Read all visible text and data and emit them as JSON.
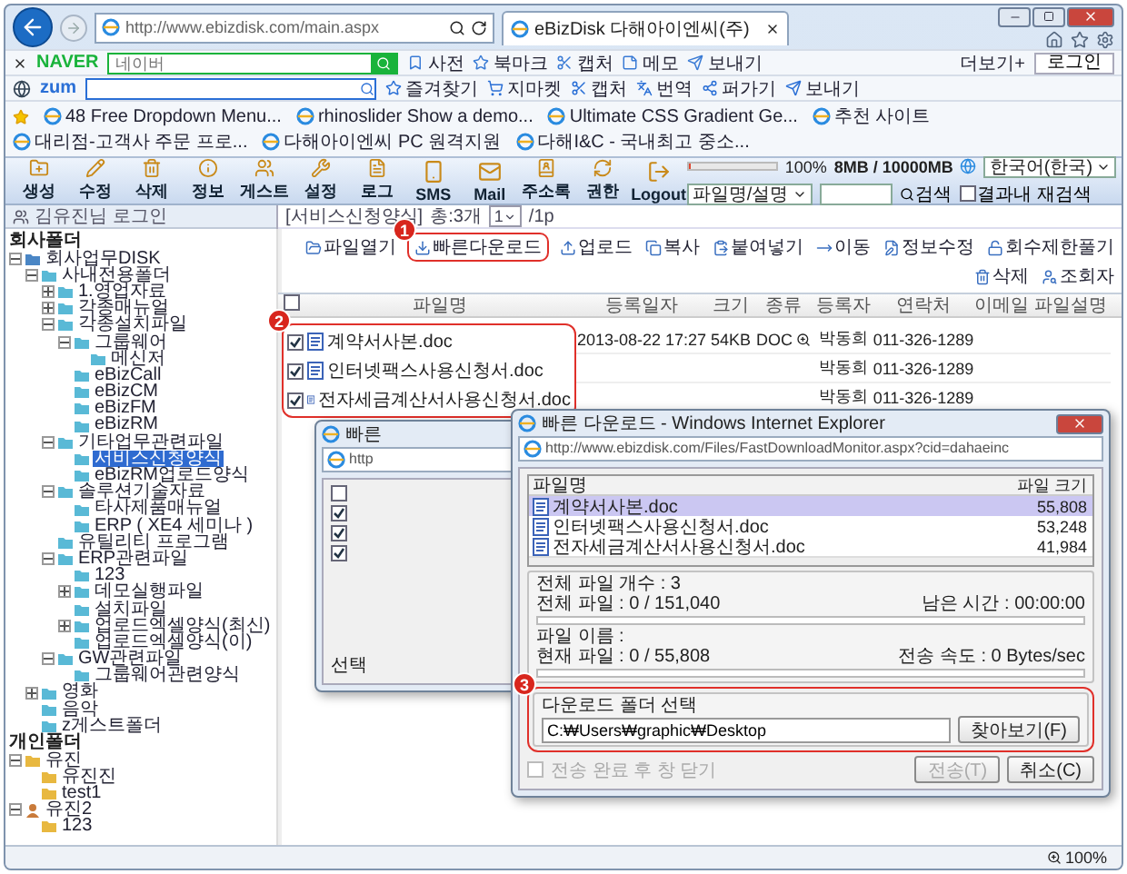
{
  "browser": {
    "address": "http://www.ebizdisk.com/main.aspx",
    "tab": "eBizDisk 다해아이엔씨(주)"
  },
  "naver_bar": {
    "logo": "NAVER",
    "search_placeholder": "네이버",
    "items": [
      "사전",
      "북마크",
      "캡처",
      "메모",
      "보내기"
    ],
    "more": "더보기+",
    "login": "로그인"
  },
  "zum_bar": {
    "logo": "zum",
    "items": [
      "즐겨찾기",
      "지마켓",
      "캡처",
      "번역",
      "퍼가기",
      "보내기"
    ]
  },
  "favorites": [
    "48 Free Dropdown Menu...",
    "rhinoslider Show a demo...",
    "Ultimate CSS Gradient Ge...",
    "추천 사이트",
    "대리점-고객사 주문 프로...",
    "다해아이엔씨 PC 원격지원",
    "다해I&C - 국내최고 중소..."
  ],
  "app_toolbar": {
    "tools": [
      "생성",
      "수정",
      "삭제",
      "정보",
      "게스트",
      "설정",
      "로그",
      "SMS",
      "Mail",
      "주소록",
      "권한",
      "Logout"
    ],
    "storage": {
      "level": 0.01,
      "percent": "100%",
      "usage": "8MB / 10000MB"
    },
    "language": "한국어(한국)",
    "search_scope": "파일명/설명",
    "search_button": "검색",
    "refine": {
      "label": "결과내 재검색",
      "checked": false
    }
  },
  "sidebar": {
    "login": "김유진님 로그인",
    "sections": [
      {
        "title": "회사폴더",
        "tree": [
          {
            "label": "회사업무DISK",
            "kind": "drive",
            "expanded": true,
            "selected": false,
            "children": [
              {
                "label": "사내전용폴더",
                "kind": "folder",
                "expanded": true,
                "selected": false,
                "children": [
                  {
                    "label": "1.영업자료",
                    "kind": "folder",
                    "expanded": false,
                    "selected": false
                  },
                  {
                    "label": "각종매뉴얼",
                    "kind": "folder",
                    "expanded": false,
                    "selected": false
                  },
                  {
                    "label": "각종설치파일",
                    "kind": "folder",
                    "expanded": true,
                    "selected": false,
                    "children": [
                      {
                        "label": "그룹웨어",
                        "kind": "folder",
                        "expanded": true,
                        "selected": false,
                        "children": [
                          {
                            "label": "메신저",
                            "kind": "folder",
                            "selected": false
                          }
                        ]
                      },
                      {
                        "label": "eBizCall",
                        "kind": "folder",
                        "selected": false
                      },
                      {
                        "label": "eBizCM",
                        "kind": "folder",
                        "selected": false
                      },
                      {
                        "label": "eBizFM",
                        "kind": "folder",
                        "selected": false
                      },
                      {
                        "label": "eBizRM",
                        "kind": "folder",
                        "selected": false
                      }
                    ]
                  },
                  {
                    "label": "기타업무관련파일",
                    "kind": "folder",
                    "expanded": true,
                    "selected": false,
                    "children": [
                      {
                        "label": "서비스신청양식",
                        "kind": "folder",
                        "selected": true
                      },
                      {
                        "label": "eBizRM업로드양식",
                        "kind": "folder",
                        "selected": false
                      }
                    ]
                  },
                  {
                    "label": "솔루션기술자료",
                    "kind": "folder",
                    "expanded": true,
                    "selected": false,
                    "children": [
                      {
                        "label": "타사제품매뉴얼",
                        "kind": "folder",
                        "selected": false
                      },
                      {
                        "label": "ERP ( XE4 세미나 )",
                        "kind": "folder",
                        "selected": false
                      }
                    ]
                  },
                  {
                    "label": "유틸리티 프로그램",
                    "kind": "folder",
                    "selected": false
                  },
                  {
                    "label": "ERP관련파일",
                    "kind": "folder",
                    "expanded": true,
                    "selected": false,
                    "children": [
                      {
                        "label": "123",
                        "kind": "folder",
                        "selected": false
                      },
                      {
                        "label": "데모실행파일",
                        "kind": "folder",
                        "expanded": false,
                        "selected": false
                      },
                      {
                        "label": "설치파일",
                        "kind": "folder",
                        "selected": false
                      },
                      {
                        "label": "업로드엑셀양식(최신)",
                        "kind": "folder",
                        "expanded": false,
                        "selected": false
                      },
                      {
                        "label": "업로드엑셀양식(이)",
                        "kind": "folder",
                        "selected": false
                      }
                    ]
                  },
                  {
                    "label": "GW관련파일",
                    "kind": "folder",
                    "expanded": true,
                    "selected": false,
                    "children": [
                      {
                        "label": "그룹웨어관련양식",
                        "kind": "folder",
                        "selected": false
                      }
                    ]
                  }
                ]
              },
              {
                "label": "영화",
                "kind": "folder",
                "expanded": false,
                "selected": false
              },
              {
                "label": "음악",
                "kind": "folder",
                "selected": false
              },
              {
                "label": "z게스트폴더",
                "kind": "folder",
                "selected": false
              }
            ]
          }
        ]
      },
      {
        "title": "개인폴더",
        "tree": [
          {
            "label": "유진",
            "kind": "personal",
            "expanded": true,
            "selected": false,
            "children": [
              {
                "label": "유진진",
                "kind": "personal",
                "selected": false
              },
              {
                "label": "test1",
                "kind": "personal",
                "selected": false
              }
            ]
          },
          {
            "label": "유진2",
            "kind": "user",
            "expanded": true,
            "selected": false,
            "children": [
              {
                "label": "123",
                "kind": "personal",
                "selected": false
              }
            ]
          }
        ]
      }
    ]
  },
  "file_list": {
    "header_checked": false,
    "path": "[서비스신청양식]",
    "count": "총:3개",
    "page": "1",
    "pages": "/1p",
    "actions": [
      "파일열기",
      "빠른다운로드",
      "업로드",
      "복사",
      "붙여넣기",
      "이동",
      "정보수정",
      "회수제한풀기",
      "삭제",
      "조회자"
    ],
    "columns": [
      "파일명",
      "등록일자",
      "크기",
      "종류",
      "등록자",
      "연락처",
      "이메일",
      "파일설명"
    ],
    "rows": [
      {
        "checked": true,
        "name": "계약서사본.doc",
        "date": "2013-08-22 17:27",
        "size": "54KB",
        "type": "DOC",
        "owner": "박동희",
        "phone": "011-326-1289"
      },
      {
        "checked": true,
        "name": "인터넷팩스사용신청서.doc",
        "owner": "박동희",
        "phone": "011-326-1289"
      },
      {
        "checked": true,
        "name": "전자세금계산서사용신청서.doc",
        "owner": "박동희",
        "phone": "011-326-1289"
      }
    ]
  },
  "callouts": [
    "1",
    "2",
    "3"
  ],
  "back_dialog": {
    "title": "빠른",
    "url": "http",
    "header_checked": false,
    "rows": [
      {
        "checked": true
      },
      {
        "checked": true
      },
      {
        "checked": true
      }
    ],
    "footer": "선택"
  },
  "dialog": {
    "title": "빠른 다운로드 - Windows Internet Explorer",
    "url": "http://www.ebizdisk.com/Files/FastDownloadMonitor.aspx?cid=dahaeinc",
    "columns": [
      "파일명",
      "파일 크기"
    ],
    "files": [
      {
        "name": "계약서사본.doc",
        "size": "55,808",
        "selected": true
      },
      {
        "name": "인터넷팩스사용신청서.doc",
        "size": "53,248",
        "selected": false
      },
      {
        "name": "전자세금계산서사용신청서.doc",
        "size": "41,984",
        "selected": false
      }
    ],
    "total_count": "전체 파일 개수 : 3",
    "total_files": "전체 파일 : 0 / 151,040",
    "remaining": "남은 시간 : 00:00:00",
    "total_progress": {
      "level": 0
    },
    "file_name": "파일 이름 :",
    "current_file": "현재 파일 : 0 / 55,808",
    "speed": "전송 속도 : 0 Bytes/sec",
    "file_progress": {
      "level": 0
    },
    "folder": {
      "label": "다운로드 폴더 선택",
      "value": "C:₩Users₩graphic₩Desktop",
      "browse": "찾아보기(F)"
    },
    "close_after": {
      "label": "전송 완료 후 창 닫기",
      "checked": false,
      "disabled": true
    },
    "buttons": [
      {
        "label": "전송(T)",
        "disabled": true
      },
      {
        "label": "취소(C)",
        "disabled": false
      }
    ]
  },
  "status_bar": {
    "zoom": "100%"
  }
}
